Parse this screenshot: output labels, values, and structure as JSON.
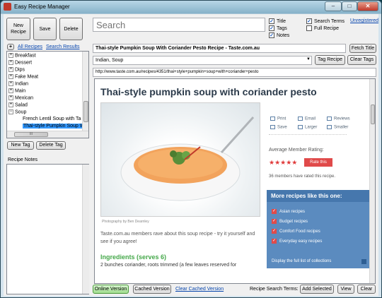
{
  "window": {
    "title": "Easy Recipe Manager",
    "min": "–",
    "max": "□",
    "close": "✕"
  },
  "toolbar": {
    "new_recipe": "New Recipe",
    "save": "Save",
    "delete": "Delete"
  },
  "search": {
    "placeholder": "Search",
    "unregistered": "Unregistered"
  },
  "filters": [
    {
      "label": "Title",
      "checked": true
    },
    {
      "label": "Tags",
      "checked": true
    },
    {
      "label": "Notes",
      "checked": true
    },
    {
      "label": "Search Terms",
      "checked": true
    },
    {
      "label": "Full Recipe",
      "checked": false
    }
  ],
  "left": {
    "plus": "+",
    "all_recipes": "All Recipes",
    "search_results": "Search Results",
    "tree": [
      {
        "label": "Breakfast",
        "expander": "+"
      },
      {
        "label": "Dessert",
        "expander": "+"
      },
      {
        "label": "Dips",
        "expander": "+"
      },
      {
        "label": "Fake Meat",
        "expander": "+"
      },
      {
        "label": "Indian",
        "expander": "+"
      },
      {
        "label": "Main",
        "expander": "+"
      },
      {
        "label": "Mexican",
        "expander": "+"
      },
      {
        "label": "Salad",
        "expander": "+"
      },
      {
        "label": "Soup",
        "expander": "−"
      },
      {
        "label": "French Lentil Soup with Ta",
        "expander": ""
      },
      {
        "label": "Thai-style Pumpkin Soup W",
        "expander": "",
        "selected": true
      }
    ],
    "hscroll_thumb": "III",
    "new_tag": "New Tag",
    "delete_tag": "Delete Tag",
    "notes_label": "Recipe Notes"
  },
  "recipe": {
    "title": "Thai-style Pumpkin Soup With Coriander Pesto Recipe - Taste.com.au",
    "fetch_title": "Fetch Title",
    "tags": "Indian, Soup",
    "tag_recipe": "Tag Recipe",
    "clear_tags": "Clear Tags",
    "url": "http://www.taste.com.au/recipes/4351/thai+style+pumpkin+soup+with+coriander+pesto"
  },
  "page": {
    "heading": "Thai-style pumpkin soup with coriander pesto",
    "photo_caption": "Photography by Ben Dearnley",
    "tools": [
      "Print",
      "Email",
      "Reviews",
      "Save",
      "Larger",
      "Smaller"
    ],
    "avg_rating_label": "Average Member Rating:",
    "stars": "★★★★★",
    "rate_this": "Rate this",
    "members": "36 members have rated this recipe.",
    "more_heading": "More recipes like this one:",
    "more_items": [
      "Asian recipes",
      "Budget recipes",
      "Comfort Food recipes",
      "Everyday easy recipes"
    ],
    "full_list": "Display the full list of collections",
    "intro": "Taste.com.au members rave about this soup recipe - try it yourself and see if you agree!",
    "ingredients_heading": "Ingredients (serves 6)",
    "ingredient_line": "2 bunches coriander, roots trimmed (a few leaves reserved for"
  },
  "statusbar": {
    "online": "Online Version",
    "cached": "Cached Version",
    "clear_cached": "Clear Cached Version",
    "search_terms_label": "Recipe Search Terms:",
    "add_selected": "Add Selected",
    "view": "View",
    "clear": "Clear"
  },
  "colors": {
    "accent_blue": "#4677ad",
    "rating_red": "#e04a4a",
    "ingredient_green": "#45a84a",
    "selection": "#3399ff"
  }
}
